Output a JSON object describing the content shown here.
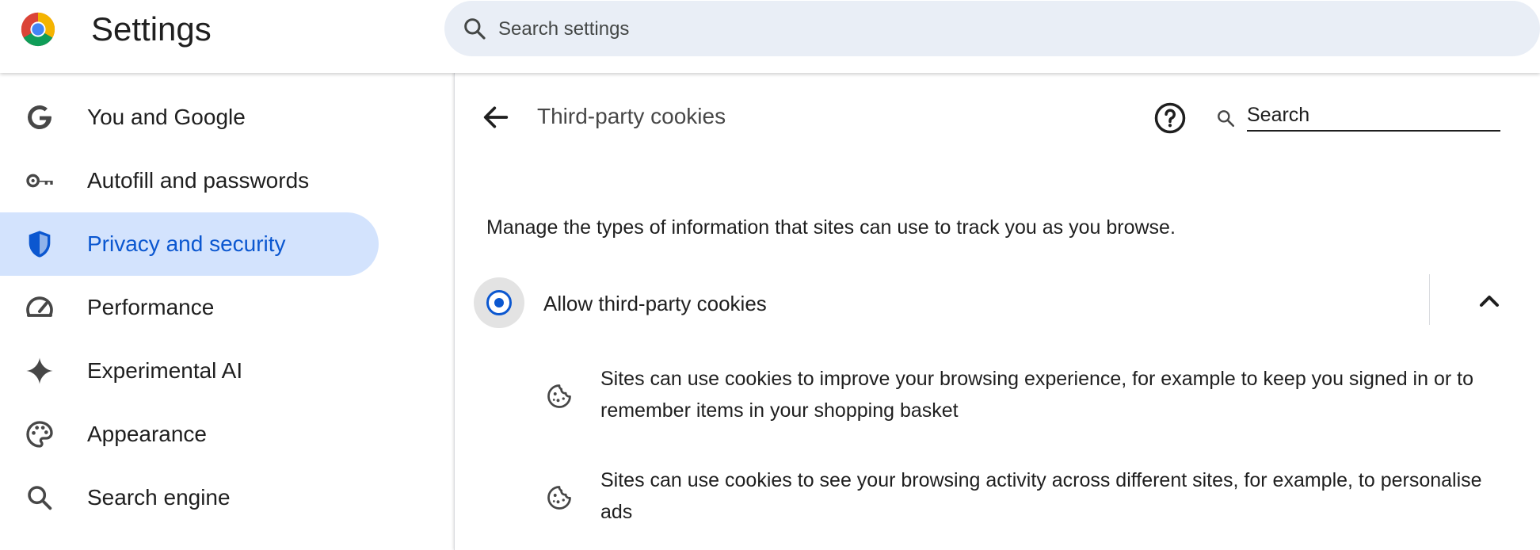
{
  "header": {
    "app_title": "Settings",
    "logo_icon": "chrome-logo-icon",
    "search": {
      "placeholder": "Search settings",
      "icon": "search-icon"
    }
  },
  "sidebar": {
    "items": [
      {
        "label": "You and Google",
        "icon": "google-g-icon",
        "active": false
      },
      {
        "label": "Autofill and passwords",
        "icon": "key-icon",
        "active": false
      },
      {
        "label": "Privacy and security",
        "icon": "shield-icon",
        "active": true
      },
      {
        "label": "Performance",
        "icon": "speedometer-icon",
        "active": false
      },
      {
        "label": "Experimental AI",
        "icon": "sparkle-icon",
        "active": false
      },
      {
        "label": "Appearance",
        "icon": "palette-icon",
        "active": false
      },
      {
        "label": "Search engine",
        "icon": "search-icon",
        "active": false
      }
    ]
  },
  "main": {
    "title": "Third-party cookies",
    "search_placeholder": "Search",
    "description": "Manage the types of information that sites can use to track you as you browse.",
    "option": {
      "label": "Allow third-party cookies",
      "selected": true,
      "expanded": true
    },
    "details": [
      {
        "icon": "cookie-icon",
        "text": "Sites can use cookies to improve your browsing experience, for example to keep you signed in or to remember items in your shopping basket"
      },
      {
        "icon": "cookie-icon",
        "text": "Sites can use cookies to see your browsing activity across different sites, for example, to personalise ads"
      }
    ]
  },
  "colors": {
    "accent": "#0b57d0",
    "active_nav_bg": "#d3e3fd",
    "search_bg": "#e9eef6",
    "text": "#1f1f1f"
  }
}
